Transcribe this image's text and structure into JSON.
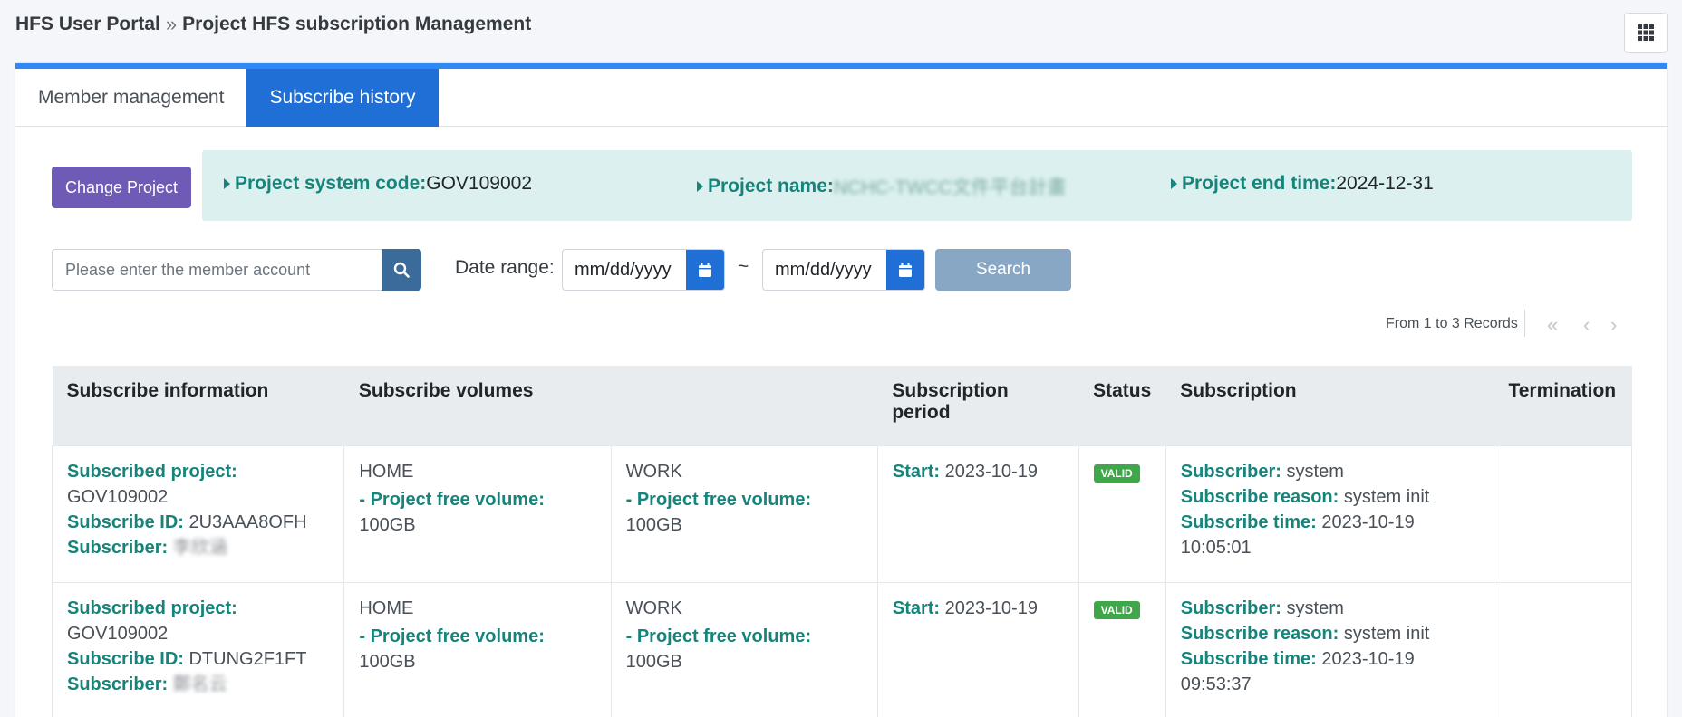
{
  "breadcrumb": {
    "root": "HFS User Portal",
    "separator": "»",
    "current": "Project HFS subscription Management"
  },
  "tabs": [
    {
      "label": "Member management"
    },
    {
      "label": "Subscribe history"
    }
  ],
  "change_project_label": "Change Project",
  "project_info": {
    "system_code_label": "Project system code:",
    "system_code": "GOV109002",
    "name_label": "Project name:",
    "name": "NCHC-TWCC文件平台計畫",
    "end_time_label": "Project end time:",
    "end_time": "2024-12-31"
  },
  "filters": {
    "member_placeholder": "Please enter the member account",
    "date_range_label": "Date range:",
    "date_from_placeholder": "mm/dd/yyyy",
    "range_sep": "~",
    "date_to_placeholder": "mm/dd/yyyy",
    "search_label": "Search"
  },
  "records_text": "From 1 to 3 Records",
  "pager": {
    "first": "«",
    "prev": "‹",
    "next": "›"
  },
  "table": {
    "headers": [
      "Subscribe information",
      "Subscribe volumes",
      "Subscription period",
      "Status",
      "Subscription",
      "Termination"
    ],
    "labels": {
      "project": "Subscribed project:",
      "id": "Subscribe ID:",
      "subscriber": "Subscriber:",
      "free_volume": "- Project free volume:",
      "start": "Start:",
      "sub_subscriber": "Subscriber:",
      "reason": "Subscribe reason:",
      "time": "Subscribe time:"
    },
    "rows": [
      {
        "project": "GOV109002",
        "id": "2U3AAA8OFH",
        "subscriber": "李欣涵",
        "vol1_name": "HOME",
        "vol1_size": "100GB",
        "vol2_name": "WORK",
        "vol2_size": "100GB",
        "start": "2023-10-19",
        "status": "VALID",
        "sub_subscriber": "system",
        "reason": "system init",
        "time": "2023-10-19 10:05:01"
      },
      {
        "project": "GOV109002",
        "id": "DTUNG2F1FT",
        "subscriber": "鄭名云",
        "vol1_name": "HOME",
        "vol1_size": "100GB",
        "vol2_name": "WORK",
        "vol2_size": "100GB",
        "start": "2023-10-19",
        "status": "VALID",
        "sub_subscriber": "system",
        "reason": "system init",
        "time": "2023-10-19 09:53:37"
      }
    ]
  },
  "colors": {
    "accent": "#1f6fd6",
    "label_green": "#17847b",
    "badge_green": "#3fa64a",
    "purple": "#6f5bb6"
  }
}
